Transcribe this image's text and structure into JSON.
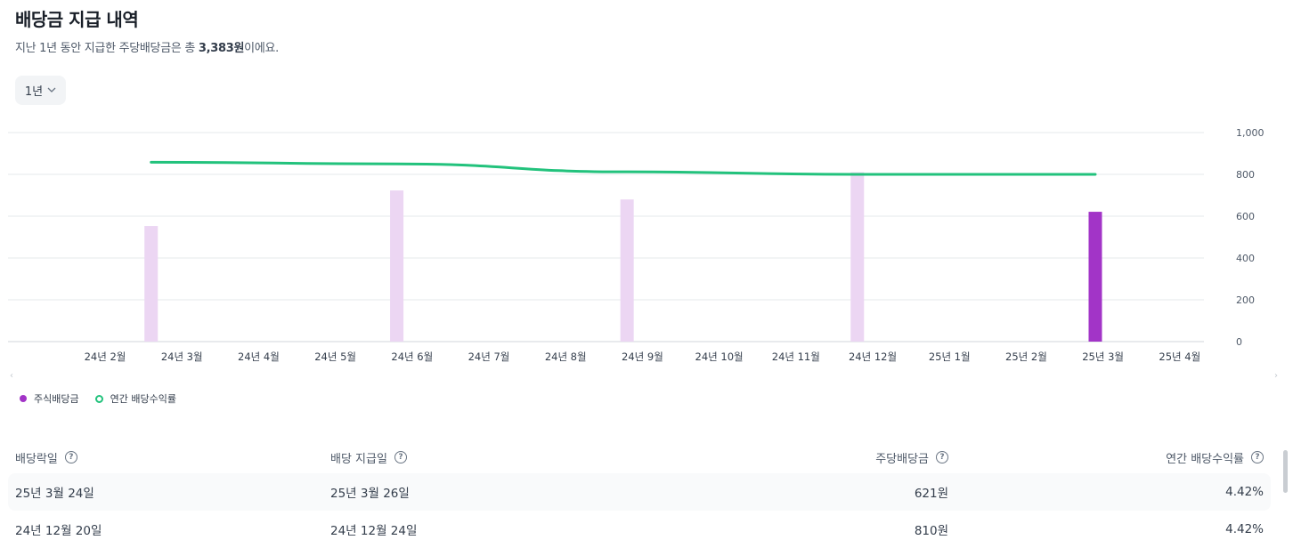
{
  "header": {
    "title": "배당금 지급 내역",
    "subtitle_prefix": "지난 1년 동안 지급한 주당배당금은 총 ",
    "subtitle_amount": "3,383원",
    "subtitle_suffix": "이에요."
  },
  "period_selector": {
    "label": "1년",
    "icon": "chevron-down-icon"
  },
  "legend": [
    {
      "label": "주식배당금",
      "marker": "filled-dot",
      "color": "#a234c7"
    },
    {
      "label": "연간 배당수익률",
      "marker": "ring-dot",
      "color": "#22c27c"
    }
  ],
  "chart_data": {
    "type": "bar",
    "title": "",
    "xlabel": "",
    "ylabel": "",
    "ylim": [
      0,
      1000
    ],
    "yticks": [
      "1,000",
      "800",
      "600",
      "400",
      "200",
      "0"
    ],
    "x_tick_labels": [
      "24년 2월",
      "24년 3월",
      "24년 4월",
      "24년 5월",
      "24년 6월",
      "24년 7월",
      "24년 8월",
      "24년 9월",
      "24년 10월",
      "24년 11월",
      "24년 12월",
      "25년 1월",
      "25년 2월",
      "25년 3월",
      "25년 4월"
    ],
    "grid": true,
    "bar_series": {
      "bars": [
        {
          "month": 2.6,
          "value": 553,
          "highlighted": false
        },
        {
          "month": 5.8,
          "value": 723,
          "highlighted": false
        },
        {
          "month": 8.8,
          "value": 680,
          "highlighted": false
        },
        {
          "month": 11.8,
          "value": 810,
          "highlighted": false
        },
        {
          "month": 14.9,
          "value": 621,
          "highlighted": true
        }
      ],
      "color": "#a234c7",
      "faded_color": "#ecd6f3"
    },
    "line_series": {
      "points": [
        {
          "month": 2.6,
          "value": 858
        },
        {
          "month": 5.8,
          "value": 850
        },
        {
          "month": 8.8,
          "value": 812
        },
        {
          "month": 11.8,
          "value": 800
        },
        {
          "month": 14.9,
          "value": 800
        }
      ],
      "color": "#22c27c"
    }
  },
  "table": {
    "headers": [
      "배당락일",
      "배당 지급일",
      "주당배당금",
      "연간 배당수익률"
    ],
    "rows": [
      [
        "25년 3월 24일",
        "25년 3월 26일",
        "621원",
        "4.42%"
      ],
      [
        "24년 12월 20일",
        "24년 12월 24일",
        "810원",
        "4.42%"
      ]
    ]
  }
}
